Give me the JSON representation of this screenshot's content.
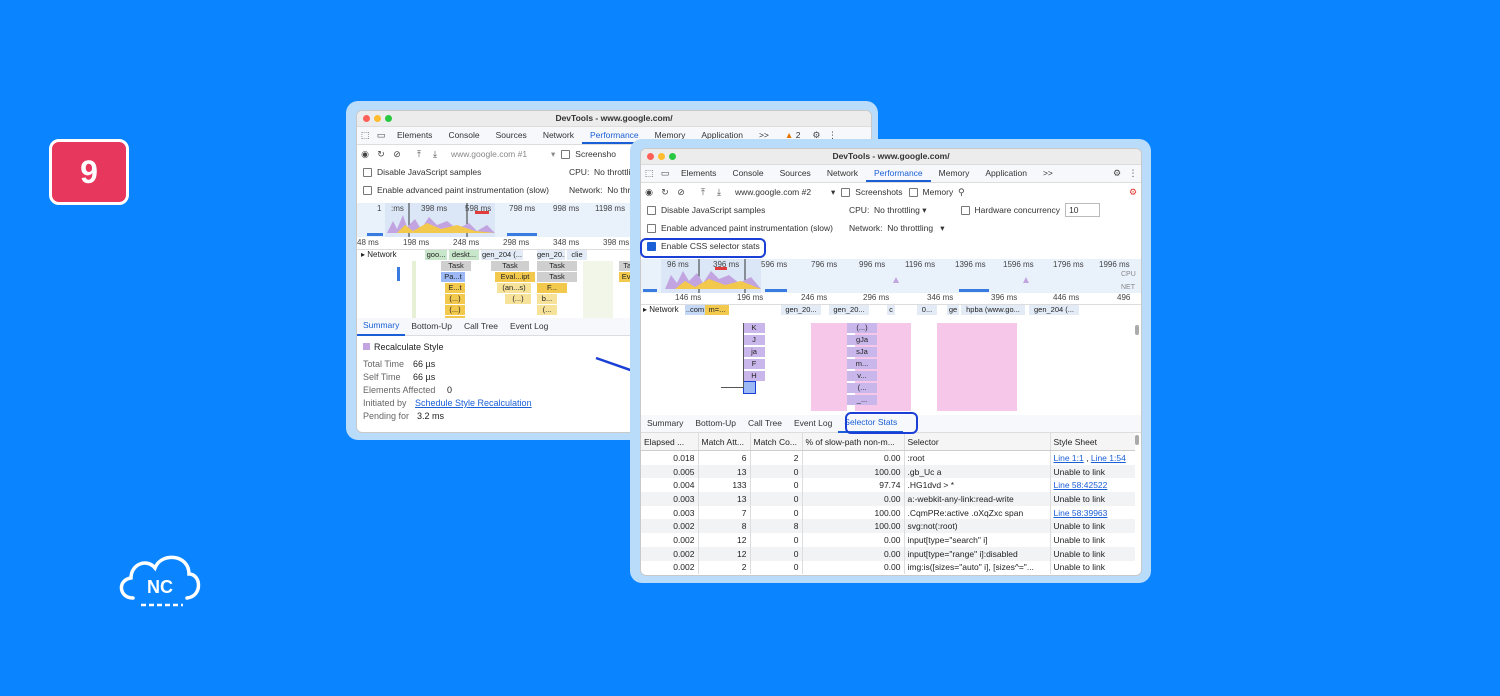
{
  "badge": "9",
  "logo_text": "NC",
  "back": {
    "title": "DevTools - www.google.com/",
    "tabs": [
      "Elements",
      "Console",
      "Sources",
      "Network",
      "Performance",
      "Memory",
      "Application",
      ">>"
    ],
    "warn_count": "2",
    "url_select": "www.google.com #1",
    "screenshots": "Screensho",
    "opt1": "Disable JavaScript samples",
    "cpu_label": "CPU:",
    "cpu_value": "No throttling",
    "opt2": "Enable advanced paint instrumentation (slow)",
    "net_label": "Network:",
    "net_value": "No thrott",
    "overview_ticks": [
      "1",
      ":ms",
      "398 ms",
      "598 ms",
      "798 ms",
      "998 ms",
      "1198 ms",
      "1"
    ],
    "ruler": [
      "48 ms",
      "198 ms",
      "248 ms",
      "298 ms",
      "348 ms",
      "398 ms",
      "4"
    ],
    "network_label": "Network",
    "net_items": [
      "goo...",
      "deskt...",
      "gen_204 (...",
      "gen_20...",
      "clie"
    ],
    "flame": [
      "Task",
      "Task",
      "Task",
      "Task",
      "Pa...t",
      "Eval...ipt",
      "Task",
      "Ev...t",
      "E...t",
      "(an...s)",
      "F...",
      "(...)",
      "(...)",
      "b...",
      "(...)",
      "(...",
      "(...)"
    ],
    "subtabs": [
      "Summary",
      "Bottom-Up",
      "Call Tree",
      "Event Log"
    ],
    "summary_title": "Recalculate Style",
    "summary": [
      {
        "k": "Total Time",
        "v": "66 µs"
      },
      {
        "k": "Self Time",
        "v": "66 µs"
      },
      {
        "k": "Elements Affected",
        "v": "0"
      },
      {
        "k": "Initiated by",
        "v": "Schedule Style Recalculation"
      },
      {
        "k": "Pending for",
        "v": "3.2 ms"
      }
    ]
  },
  "front": {
    "title": "DevTools - www.google.com/",
    "tabs": [
      "Elements",
      "Console",
      "Sources",
      "Network",
      "Performance",
      "Memory",
      "Application",
      ">>"
    ],
    "url_select": "www.google.com #2",
    "screenshots": "Screenshots",
    "memory": "Memory",
    "opt1": "Disable JavaScript samples",
    "cpu_label": "CPU:",
    "cpu_value": "No throttling",
    "hw_label": "Hardware concurrency",
    "hw_value": "10",
    "opt2": "Enable advanced paint instrumentation (slow)",
    "net_label": "Network:",
    "net_value": "No throttling",
    "opt3": "Enable CSS selector stats",
    "overview_ticks": [
      "96 ms",
      "396 ms",
      "596 ms",
      "796 ms",
      "996 ms",
      "1196 ms",
      "1396 ms",
      "1596 ms",
      "1796 ms",
      "1996 ms"
    ],
    "cpu_tag": "CPU",
    "net_tag": "NET",
    "ruler": [
      "146 ms",
      "196 ms",
      "246 ms",
      "296 ms",
      "346 ms",
      "396 ms",
      "446 ms",
      "496"
    ],
    "network_label": "Network",
    "net_items": [
      "..com",
      "m=...",
      "gen_20...",
      "gen_20...",
      "c",
      "0...",
      "ge",
      "hpba (www.go...",
      "gen_204 (..."
    ],
    "flame_a": [
      "K",
      "J",
      "ja",
      "F",
      "H"
    ],
    "flame_b": [
      "(...)",
      "gJa",
      "sJa",
      "m...",
      "v...",
      "(...",
      "_..."
    ],
    "subtabs": [
      "Summary",
      "Bottom-Up",
      "Call Tree",
      "Event Log",
      "Selector Stats"
    ],
    "columns": [
      "Elapsed ...",
      "Match Att...",
      "Match Co...",
      "% of slow-path non-m...",
      "Selector",
      "Style Sheet"
    ],
    "rows": [
      {
        "elapsed": "0.018",
        "att": "6",
        "co": "2",
        "pct": "0.00",
        "sel": ":root",
        "sheet": "Line 1:1",
        "sheet2": "Line 1:54",
        "link": true
      },
      {
        "elapsed": "0.005",
        "att": "13",
        "co": "0",
        "pct": "100.00",
        "sel": ".gb_Uc a",
        "sheet": "Unable to link",
        "link": false
      },
      {
        "elapsed": "0.004",
        "att": "133",
        "co": "0",
        "pct": "97.74",
        ".sel": "",
        "sel": ".HG1dvd > *",
        "sheet": "Line 58:42522",
        "link": true
      },
      {
        "elapsed": "0.003",
        "att": "13",
        "co": "0",
        "pct": "0.00",
        "sel": "a:-webkit-any-link:read-write",
        "sheet": "Unable to link",
        "link": false
      },
      {
        "elapsed": "0.003",
        "att": "7",
        "co": "0",
        "pct": "100.00",
        "sel": ".CqmPRe:active .oXqZxc span",
        "sheet": "Line 58:39963",
        "link": true
      },
      {
        "elapsed": "0.002",
        "att": "8",
        "co": "8",
        "pct": "100.00",
        "sel": "svg:not(:root)",
        "sheet": "Unable to link",
        "link": false
      },
      {
        "elapsed": "0.002",
        "att": "12",
        "co": "0",
        "pct": "0.00",
        "sel": "input[type=\"search\" i]",
        "sheet": "Unable to link",
        "link": false
      },
      {
        "elapsed": "0.002",
        "att": "12",
        "co": "0",
        "pct": "0.00",
        "sel": "input[type=\"range\" i]:disabled",
        "sheet": "Unable to link",
        "link": false
      },
      {
        "elapsed": "0.002",
        "att": "2",
        "co": "0",
        "pct": "0.00",
        "sel": "img:is([sizes=\"auto\" i], [sizes^=\"...",
        "sheet": "Unable to link",
        "link": false
      }
    ]
  },
  "colors": {
    "background": "#0a84ff",
    "badge": "#e8375d",
    "accent": "#1a5fd6",
    "highlight": "#1a3fd6"
  }
}
